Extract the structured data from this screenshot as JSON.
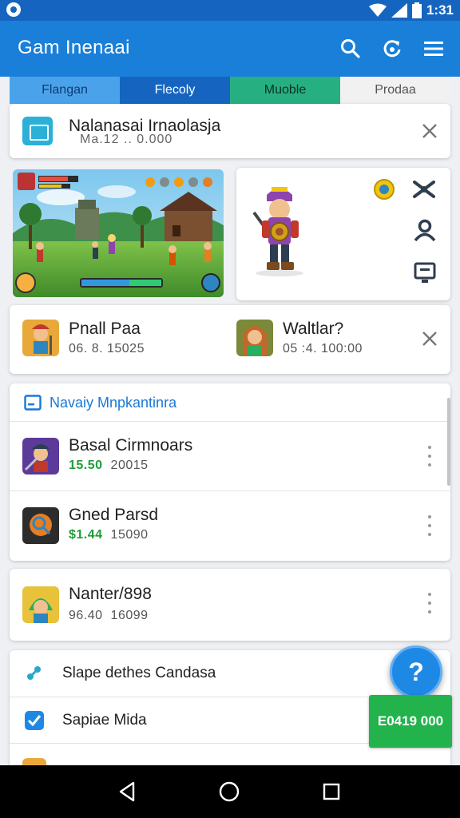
{
  "status_bar": {
    "time": "1:31",
    "icons": [
      "wifi-icon",
      "signal-icon",
      "battery-icon"
    ]
  },
  "app_bar": {
    "title": "Gam Inenaai",
    "actions": [
      "search-icon",
      "refresh-icon",
      "menu-icon"
    ]
  },
  "tabs": [
    {
      "label": "Flangan"
    },
    {
      "label": "Flecoly"
    },
    {
      "label": "Muoble"
    },
    {
      "label": "Prodaa"
    }
  ],
  "notice": {
    "title": "Nalanasai Irnaolasja",
    "subtitle": "Ma.12 .. 0.000",
    "icon": "app-icon"
  },
  "character_panel": {
    "icons": [
      "coin-icon",
      "sword-icon",
      "user-icon",
      "screen-icon"
    ]
  },
  "featured": [
    {
      "name": "Pnall Paa",
      "meta": "06. 8.   15025"
    },
    {
      "name": "Waltlar?",
      "meta": "05 :4.   100:00"
    }
  ],
  "section": {
    "title": "Navaiy Mnpkantinra",
    "items": [
      {
        "name": "Basal Cirmnoars",
        "price": "15.50",
        "count": "20015"
      },
      {
        "name": "Gned Parsd",
        "price": "$1.44",
        "count": "15090"
      }
    ]
  },
  "single_item": {
    "name": "Nanter/898",
    "price": "96.40",
    "count": "16099"
  },
  "bottom": {
    "rows": [
      {
        "label": "Slape  dethes Candasa",
        "icon": "puzzle-icon"
      },
      {
        "label": "Sapiae Mida",
        "icon": "checkbox-icon"
      }
    ]
  },
  "fab": {
    "label": "?"
  },
  "green_button": {
    "label": "E0419 000"
  },
  "colors": {
    "primary": "#1a7fd8",
    "status": "#1565c0",
    "accent_green": "#22b34c",
    "price_green": "#1f9c3a"
  }
}
